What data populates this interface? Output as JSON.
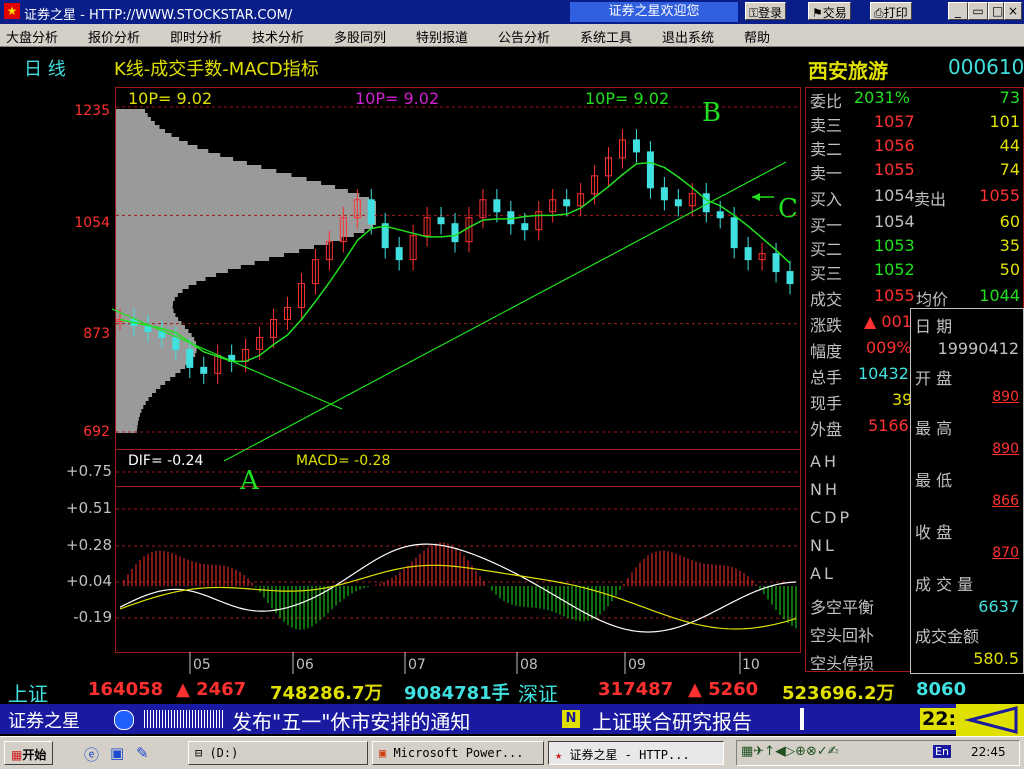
{
  "colors": {
    "up": "#ff3030",
    "down": "#40e0e0",
    "ma": "#20e020",
    "dif": "#ffffff",
    "dea": "#e0e000",
    "grid": "#a01818",
    "text_label": "#c0c0c0"
  },
  "titlebar": {
    "app_icon": "flag-icon",
    "title": "证券之星 - HTTP://WWW.STOCKSTAR.COM/",
    "welcome": "证券之星欢迎您",
    "login": "登录",
    "trade": "交易",
    "print": "打印"
  },
  "menu": [
    "大盘分析",
    "报价分析",
    "即时分析",
    "技术分析",
    "多股同列",
    "特别报道",
    "公告分析",
    "系统工具",
    "退出系统",
    "帮助"
  ],
  "chart_header": {
    "period_label": "日 线",
    "title": "K线-成交手数-MACD指标",
    "ma1": "10P=  9.02",
    "ma2": "10P=  9.02",
    "ma3": "10P=  9.02"
  },
  "stock": {
    "name": "西安旅游",
    "code": "000610"
  },
  "price_axis": [
    "1235",
    "1054",
    "873",
    "692"
  ],
  "macd_axis": [
    "+0.75",
    "+0.51",
    "+0.28",
    "+0.04",
    "-0.19"
  ],
  "macd_header": {
    "dif": "DIF=  -0.24",
    "macd": "MACD=  -0.28"
  },
  "annotations": {
    "a": "A",
    "b": "B",
    "c": "C"
  },
  "month_labels": [
    "05",
    "06",
    "07",
    "08",
    "09",
    "10"
  ],
  "orderbook": {
    "ratio_label": "委比",
    "ratio_value": "2031%",
    "ratio_count": "73",
    "sell3_label": "卖三",
    "sell3_price": "1057",
    "sell3_vol": "101",
    "sell2_label": "卖二",
    "sell2_price": "1056",
    "sell2_vol": "44",
    "sell1_label": "卖一",
    "sell1_price": "1055",
    "sell1_vol": "74",
    "buy_in_label": "买入",
    "buy_in_price": "1054",
    "sell_out_label": "卖出",
    "sell_out_price": "1055",
    "buy1_label": "买一",
    "buy1_price": "1054",
    "buy1_vol": "60",
    "buy2_label": "买二",
    "buy2_price": "1053",
    "buy2_vol": "35",
    "buy3_label": "买三",
    "buy3_price": "1052",
    "buy3_vol": "50"
  },
  "quote": {
    "volume_label": "成交",
    "volume_value": "1055",
    "avg_label": "均价",
    "avg_value": "1044",
    "change_label": "涨跌",
    "change_value": "▲ 001",
    "range_label": "幅度",
    "range_value": "009%",
    "total_label": "总手",
    "total_value": "10432",
    "now_label": "现手",
    "now_value": "39",
    "outer_label": "外盘",
    "outer_value": "5166"
  },
  "indicators": [
    "AH",
    "NH",
    "CDP",
    "NL",
    "AL"
  ],
  "signals": [
    "多空平衡",
    "空头回补",
    "空头停损"
  ],
  "popup": {
    "date_label": "日    期",
    "date_value": "19990412",
    "open_label": "开    盘",
    "open_value": "890",
    "high_label": "最    高",
    "high_value": "890",
    "low_label": "最    低",
    "low_value": "866",
    "close_label": "收    盘",
    "close_value": "870",
    "vol_label": "成 交 量",
    "vol_value": "6637",
    "amount_label": "成交金额",
    "amount_value": "580.5"
  },
  "ticker": {
    "sh_label": "上证",
    "sh_index": "164058",
    "sh_change": "▲ 2467",
    "sh_amount": "748286.7万",
    "sh_volume": "9084781手",
    "sz_label": "深证",
    "sz_index": "317487",
    "sz_change": "▲ 5260",
    "sz_amount": "523696.2万",
    "sz_volume": "8060"
  },
  "newsbar": {
    "brand": "证券之星",
    "news1": "发布\"五一\"休市安排的通知",
    "news2": "上证联合研究报告",
    "clock": "22:4"
  },
  "taskbar": {
    "start": "开始",
    "drive": "(D:)",
    "powerpoint": "Microsoft Power...",
    "stockstar": "证券之星 - HTTP...",
    "lang": "En",
    "time": "22:45"
  },
  "chart_data": {
    "type": "candlestick",
    "title": "K线-成交手数-MACD指标",
    "x_labels": [
      "05",
      "06",
      "07",
      "08",
      "09",
      "10"
    ],
    "ylim": [
      692,
      1235
    ],
    "y_ticks": [
      692,
      873,
      1054,
      1235
    ],
    "close_series": [
      880,
      870,
      860,
      850,
      830,
      800,
      790,
      820,
      810,
      830,
      850,
      880,
      900,
      940,
      980,
      1010,
      1050,
      1080,
      1040,
      1000,
      980,
      1020,
      1050,
      1040,
      1010,
      1050,
      1080,
      1060,
      1040,
      1030,
      1060,
      1080,
      1070,
      1090,
      1120,
      1150,
      1180,
      1160,
      1100,
      1080,
      1070,
      1090,
      1060,
      1050,
      1000,
      980,
      990,
      960,
      940
    ]
  }
}
